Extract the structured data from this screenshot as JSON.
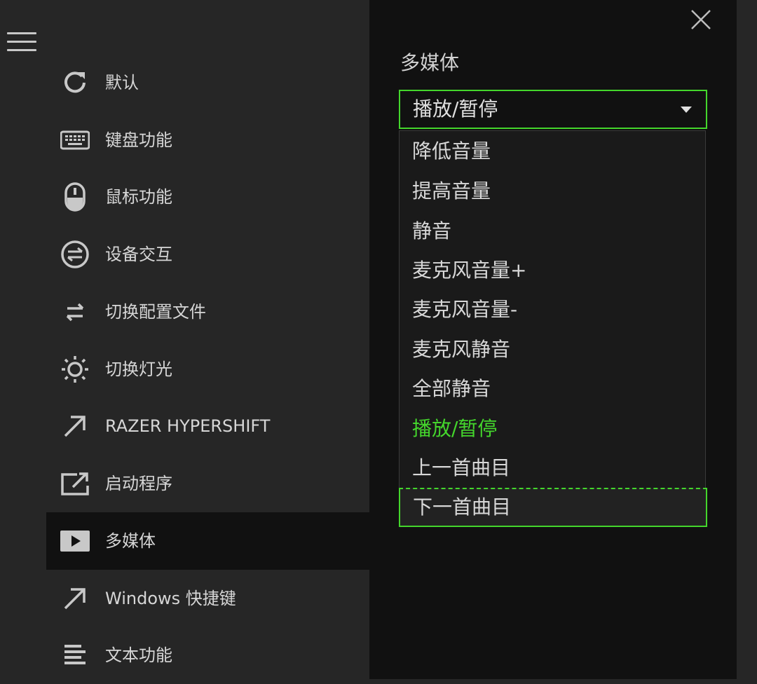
{
  "sidebar": {
    "items": [
      {
        "label": "默认",
        "icon": "refresh-icon"
      },
      {
        "label": "键盘功能",
        "icon": "keyboard-icon"
      },
      {
        "label": "鼠标功能",
        "icon": "mouse-icon"
      },
      {
        "label": "设备交互",
        "icon": "swap-circle-icon"
      },
      {
        "label": "切换配置文件",
        "icon": "swap-arrows-icon"
      },
      {
        "label": "切换灯光",
        "icon": "light-icon"
      },
      {
        "label": "RAZER HYPERSHIFT",
        "icon": "arrow-up-right-icon"
      },
      {
        "label": "启动程序",
        "icon": "launch-icon"
      },
      {
        "label": "多媒体",
        "icon": "play-icon",
        "active": true
      },
      {
        "label": "Windows 快捷键",
        "icon": "arrow-up-right-icon"
      },
      {
        "label": "文本功能",
        "icon": "text-icon"
      }
    ]
  },
  "panel": {
    "title": "多媒体",
    "select": {
      "value": "播放/暂停",
      "options": [
        "降低音量",
        "提高音量",
        "静音",
        "麦克风音量+",
        "麦克风音量-",
        "麦克风静音",
        "全部静音",
        "播放/暂停",
        "上一首曲目",
        "下一首曲目"
      ],
      "selected_index": 7,
      "focused_index": 9
    }
  },
  "colors": {
    "accent": "#44d62c",
    "sidebar_bg": "#262626",
    "panel_bg": "#111111",
    "text": "#d6d6d6"
  }
}
